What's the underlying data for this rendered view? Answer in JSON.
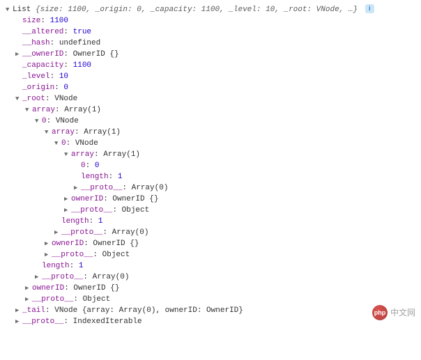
{
  "tokens": {
    "undefined": "undefined",
    "true": "true"
  },
  "header": {
    "type": "List",
    "summary": "{size: 1100, _origin: 0, _capacity: 1100, _level: 10, _root: VNode, …}",
    "badge": "i"
  },
  "top": {
    "size": {
      "key": "size",
      "val": "1100"
    },
    "altered": {
      "key": "__altered",
      "val": "true"
    },
    "hash": {
      "key": "__hash",
      "val": "undefined"
    },
    "ownerID": {
      "key": "__ownerID",
      "val": "OwnerID {}"
    },
    "capacity": {
      "key": "_capacity",
      "val": "1100"
    },
    "level": {
      "key": "_level",
      "val": "10"
    },
    "origin": {
      "key": "_origin",
      "val": "0"
    }
  },
  "root": {
    "key": "_root",
    "type": "VNode",
    "array": {
      "key": "array",
      "type": "Array(1)"
    },
    "idx0": {
      "key": "0",
      "type": "VNode"
    },
    "inner_array": {
      "key": "array",
      "type": "Array(1)"
    },
    "inner_idx0": {
      "key": "0",
      "type": "VNode"
    },
    "deep_array": {
      "key": "array",
      "type": "Array(1)"
    },
    "deep_idx0": {
      "key": "0",
      "val": "0"
    },
    "length": {
      "key": "length",
      "val": "1"
    },
    "proto_arr": {
      "key": "__proto__",
      "val": "Array(0)"
    },
    "ownerID": {
      "key": "ownerID",
      "val": "OwnerID {}"
    },
    "proto_obj": {
      "key": "__proto__",
      "val": "Object"
    }
  },
  "tail": {
    "key": "_tail",
    "val": "VNode {array: Array(0), ownerID: OwnerID}"
  },
  "proto": {
    "key": "__proto__",
    "val": "IndexedIterable"
  },
  "watermark": {
    "brand": "php",
    "text": "中文网"
  }
}
